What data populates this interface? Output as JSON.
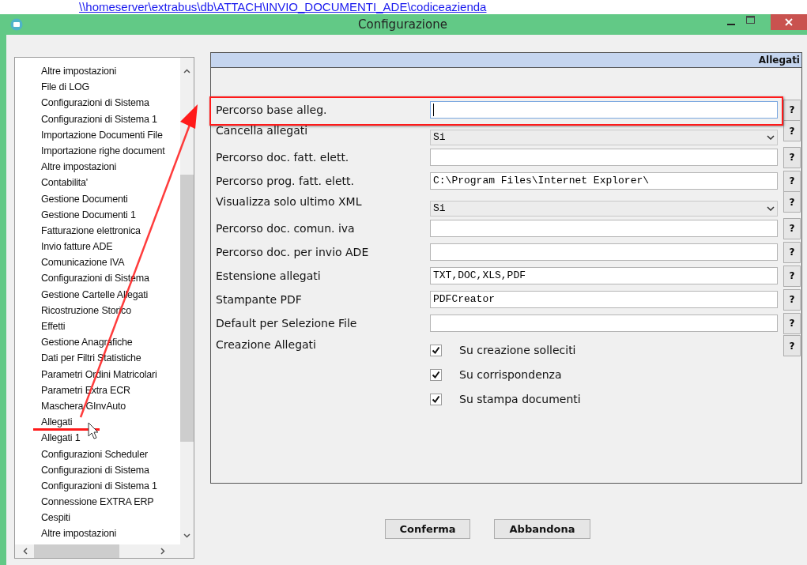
{
  "link_path": "\\\\homeserver\\extrabus\\db\\ATTACH\\INVIO_DOCUMENTI_ADE\\codiceazienda",
  "window": {
    "title": "Configurazione"
  },
  "sidebar": {
    "items": [
      "Altre impostazioni",
      "File di LOG",
      "Configurazioni di Sistema",
      "Configurazioni di Sistema 1",
      "Importazione Documenti File",
      "Importazione righe document",
      "Altre impostazioni",
      "Contabilita'",
      "Gestione Documenti",
      "Gestione Documenti 1",
      "Fatturazione elettronica",
      "Invio fatture ADE",
      "Comunicazione IVA",
      "Configurazioni di Sistema",
      "Gestione Cartelle Allegati",
      "Ricostruzione Storico",
      "Effetti",
      "Gestione Anagrafiche",
      "Dati per Filtri Statistiche",
      "Parametri Ordini Matricolari",
      "Parametri Extra ECR",
      "Maschera GInvAuto",
      "Allegati",
      "Allegati 1",
      "Configurazioni Scheduler",
      "Configurazioni di Sistema",
      "Configurazioni di Sistema 1",
      "Connessione EXTRA ERP",
      "Cespiti",
      "Altre impostazioni"
    ]
  },
  "panel": {
    "title": "Allegati",
    "help_label": "?",
    "rows": [
      {
        "kind": "text",
        "label": "Percorso base alleg.",
        "focused": true
      },
      {
        "kind": "select",
        "label": "Cancella allegati",
        "value": "Si"
      },
      {
        "kind": "text",
        "label": "Percorso doc. fatt. elett.",
        "focused": false
      },
      {
        "kind": "text",
        "label": "Percorso prog. fatt. elett.",
        "value": "C:\\Program Files\\Internet Explorer\\",
        "focused": false
      },
      {
        "kind": "select",
        "label": "Visualizza solo ultimo XML",
        "value": "Si"
      },
      {
        "kind": "text",
        "label": "Percorso doc. comun. iva",
        "focused": false
      },
      {
        "kind": "text",
        "label": "Percorso doc. per invio ADE",
        "focused": false
      },
      {
        "kind": "text",
        "label": "Estensione allegati",
        "value": "TXT,DOC,XLS,PDF",
        "focused": false
      },
      {
        "kind": "text",
        "label": "Stampante PDF",
        "value": "PDFCreator",
        "focused": false
      },
      {
        "kind": "text",
        "label": "Default per Selezione File",
        "focused": false
      },
      {
        "kind": "checks",
        "label": "Creazione Allegati",
        "checks": [
          {
            "label": "Su creazione solleciti",
            "checked": true
          },
          {
            "label": "Su corrispondenza",
            "checked": true
          },
          {
            "label": "Su stampa documenti",
            "checked": true
          }
        ]
      }
    ]
  },
  "buttons": [
    "Conferma",
    "Abbandona"
  ]
}
